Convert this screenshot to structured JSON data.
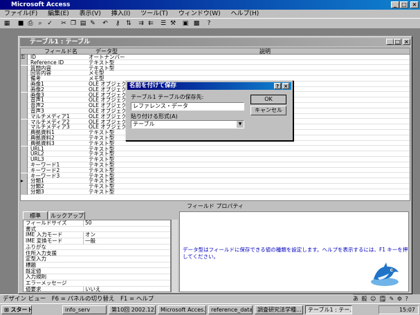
{
  "app": {
    "title": "Microsoft Access",
    "menu": [
      "ファイル(F)",
      "編集(E)",
      "表示(V)",
      "挿入(I)",
      "ツール(T)",
      "ウィンドウ(W)",
      "ヘルプ(H)"
    ]
  },
  "window": {
    "title": "テーブル1 : テーブル",
    "columns": [
      "フィールド名",
      "データ型",
      "説明"
    ],
    "fields": [
      {
        "name": "ID",
        "type": "オートナンバー"
      },
      {
        "name": "Reference ID",
        "type": "テキスト型"
      },
      {
        "name": "質問内容",
        "type": "テキスト型"
      },
      {
        "name": "回答内容",
        "type": "メモ型"
      },
      {
        "name": "備考",
        "type": "メモ型"
      },
      {
        "name": "画像1",
        "type": "OLE オブジェクト"
      },
      {
        "name": "画像2",
        "type": "OLE オブジェクト"
      },
      {
        "name": "画像3",
        "type": "OLE オブジェクト"
      },
      {
        "name": "音声1",
        "type": "OLE オブジェクト"
      },
      {
        "name": "音声2",
        "type": "OLE オブジェクト"
      },
      {
        "name": "音声3",
        "type": "OLE オブジェクト"
      },
      {
        "name": "マルチメディア1",
        "type": "OLE オブジェクト"
      },
      {
        "name": "マルチメディア2",
        "type": "OLE オブジェクト"
      },
      {
        "name": "マルチメディア3",
        "type": "OLE オブジェクト"
      },
      {
        "name": "典拠資料1",
        "type": "テキスト型"
      },
      {
        "name": "典拠資料2",
        "type": "テキスト型"
      },
      {
        "name": "典拠資料3",
        "type": "テキスト型"
      },
      {
        "name": "URL1",
        "type": "テキスト型"
      },
      {
        "name": "URL2",
        "type": "テキスト型"
      },
      {
        "name": "URL3",
        "type": "テキスト型"
      },
      {
        "name": "キーワード1",
        "type": "テキスト型"
      },
      {
        "name": "キーワード2",
        "type": "テキスト型"
      },
      {
        "name": "キーワード3",
        "type": "テキスト型"
      },
      {
        "name": "分類1",
        "type": "テキスト型"
      },
      {
        "name": "分類2",
        "type": "テキスト型"
      },
      {
        "name": "分類3",
        "type": "テキスト型"
      }
    ],
    "field_properties_label": "フィールド プロパティ",
    "tabs": [
      "標準",
      "ルックアップ"
    ],
    "properties": [
      {
        "label": "フィールドサイズ",
        "value": "50"
      },
      {
        "label": "書式",
        "value": ""
      },
      {
        "label": "IME 入力モード",
        "value": "オン"
      },
      {
        "label": "IME 変換モード",
        "value": "一般"
      },
      {
        "label": "ふりがな",
        "value": ""
      },
      {
        "label": "住所入力支援",
        "value": ""
      },
      {
        "label": "定型入力",
        "value": ""
      },
      {
        "label": "標題",
        "value": ""
      },
      {
        "label": "既定値",
        "value": ""
      },
      {
        "label": "入力規則",
        "value": ""
      },
      {
        "label": "エラーメッセージ",
        "value": ""
      },
      {
        "label": "値要求",
        "value": "いいえ"
      }
    ],
    "help_text": "データ型はフィールドに保存できる値の種類を設定します。ヘルプを表示するには、F1 キーを押してください。"
  },
  "dialog": {
    "title": "名前を付けて保存",
    "save_label": "テーブル1 テーブルの保存先:",
    "save_value": "レファレンス・データ",
    "format_label": "貼り付ける形式(A)",
    "format_value": "テーブル",
    "ok": "OK",
    "cancel": "キャンセル",
    "help": "?"
  },
  "statusbar": {
    "text": "デザイン ビュー　F6 = パネルの切り替え　F1 = ヘルプ",
    "ime": "あ 般 ☺ 🗒 ✎ ⚙ ?"
  },
  "taskbar": {
    "start": "スタート",
    "tasks": [
      "info_serv",
      "第10回 2002.12.3...",
      "Microsoft Acces...",
      "reference_data_e...",
      "調査研究法学種...",
      "テーブル1 : テー..."
    ],
    "clock": "15:07"
  }
}
